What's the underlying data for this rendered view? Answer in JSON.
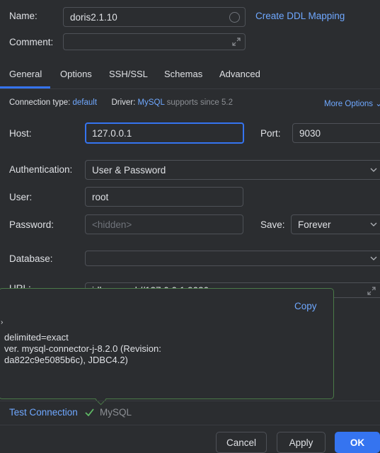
{
  "name": {
    "label": "Name:",
    "value": "doris2.1.10",
    "link": "Create DDL Mapping"
  },
  "comment": {
    "label": "Comment:",
    "value": ""
  },
  "tabs": [
    "General",
    "Options",
    "SSH/SSL",
    "Schemas",
    "Advanced"
  ],
  "active_tab": "General",
  "connection_info": {
    "type_label": "Connection type:",
    "type_value": "default",
    "driver_label": "Driver:",
    "driver_value": "MySQL",
    "driver_note": "supports since 5.2",
    "more_options": "More Options"
  },
  "host": {
    "label": "Host:",
    "value": "127.0.0.1"
  },
  "port": {
    "label": "Port:",
    "value": "9030"
  },
  "authentication": {
    "label": "Authentication:",
    "value": "User & Password"
  },
  "user": {
    "label": "User:",
    "value": "root"
  },
  "password": {
    "label": "Password:",
    "placeholder": "<hidden>"
  },
  "save": {
    "label": "Save:",
    "value": "Forever"
  },
  "database": {
    "label": "Database:",
    "value": ""
  },
  "url": {
    "label": "URL:",
    "value": "jdbc:mysql://127.0.0.1:9030"
  },
  "popup": {
    "copy": "Copy",
    "lines": [
      "delimited=exact",
      "ver. mysql-connector-j-8.2.0 (Revision:",
      "da822c9e5085b6c), JDBC4.2)"
    ]
  },
  "test_connection": {
    "label": "Test Connection",
    "status": "MySQL"
  },
  "buttons": {
    "cancel": "Cancel",
    "apply": "Apply",
    "ok": "OK"
  },
  "colors": {
    "accent": "#3574f0",
    "link": "#6fa8ff",
    "success": "#5fb865",
    "popup_border": "#4a7a48"
  }
}
